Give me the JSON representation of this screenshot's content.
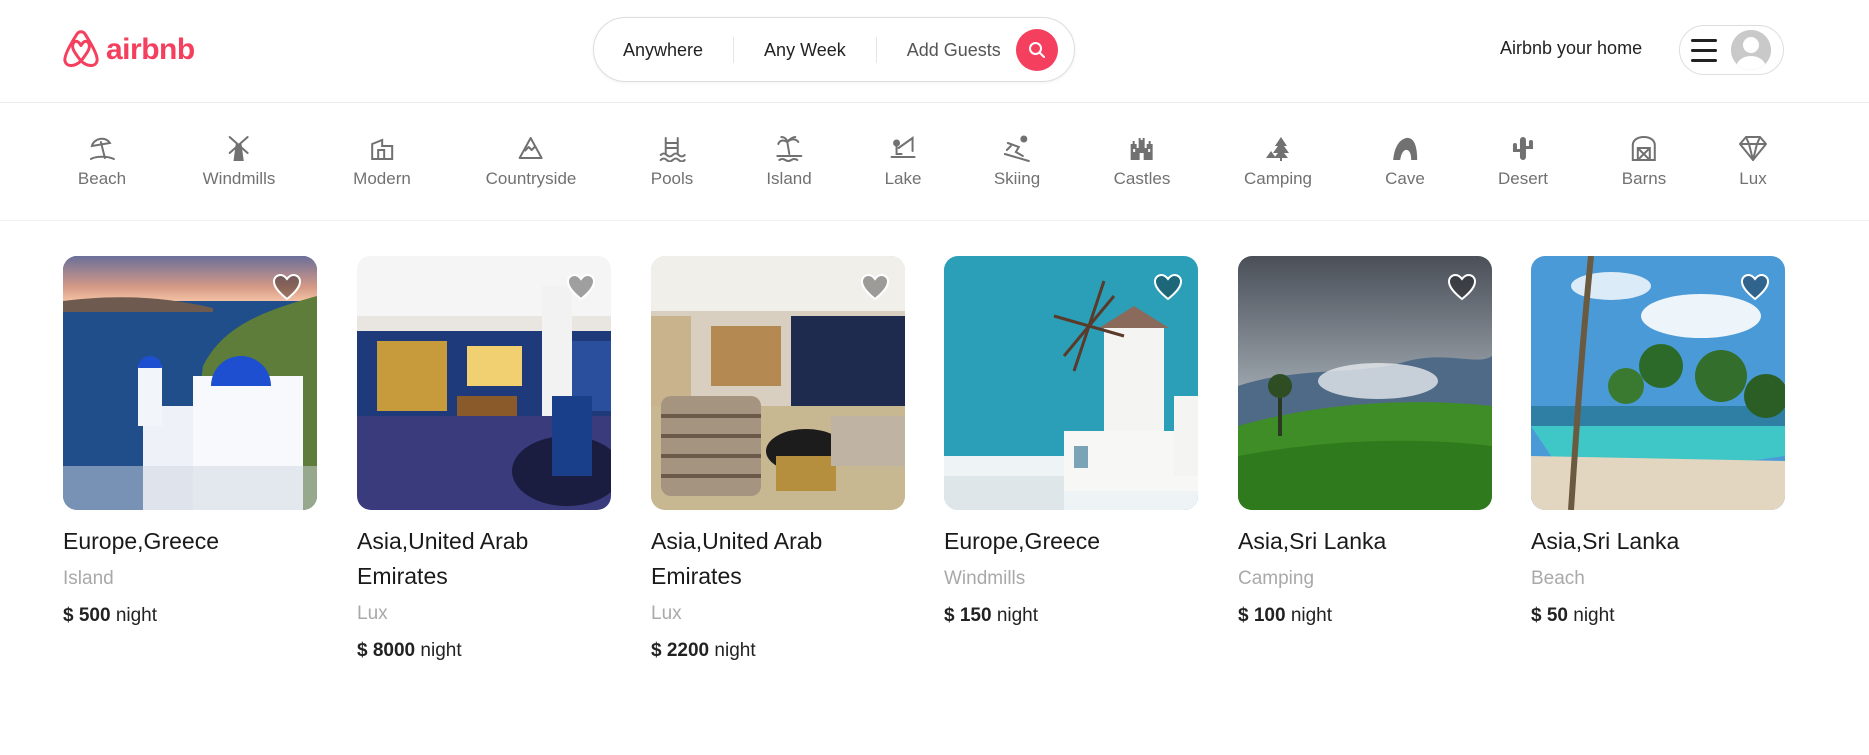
{
  "brand": {
    "name": "airbnb",
    "color": "#f43f5e"
  },
  "search": {
    "where": "Anywhere",
    "when": "Any Week",
    "guests": "Add Guests",
    "button_icon": "search-icon"
  },
  "header": {
    "host_link": "Airbnb your home",
    "menu_icon": "hamburger-icon",
    "avatar_icon": "user-avatar-icon"
  },
  "categories": [
    {
      "label": "Beach",
      "icon": "beach-umbrella-icon"
    },
    {
      "label": "Windmills",
      "icon": "windmill-icon"
    },
    {
      "label": "Modern",
      "icon": "modern-house-icon"
    },
    {
      "label": "Countryside",
      "icon": "mountain-icon"
    },
    {
      "label": "Pools",
      "icon": "pool-icon"
    },
    {
      "label": "Island",
      "icon": "island-palm-icon"
    },
    {
      "label": "Lake",
      "icon": "lake-fishing-icon"
    },
    {
      "label": "Skiing",
      "icon": "skiing-icon"
    },
    {
      "label": "Castles",
      "icon": "castle-icon"
    },
    {
      "label": "Camping",
      "icon": "camping-tree-icon"
    },
    {
      "label": "Cave",
      "icon": "cave-icon"
    },
    {
      "label": "Desert",
      "icon": "cactus-icon"
    },
    {
      "label": "Barns",
      "icon": "barn-icon"
    },
    {
      "label": "Lux",
      "icon": "diamond-icon"
    }
  ],
  "listings": [
    {
      "location": "Europe,Greece",
      "category": "Island",
      "price": "$ 500",
      "unit": "night",
      "photo": "santorini-blue-domes"
    },
    {
      "location": "Asia,United Arab Emirates",
      "category": "Lux",
      "price": "$ 8000",
      "unit": "night",
      "photo": "luxury-hotel-suite"
    },
    {
      "location": "Asia,United Arab Emirates",
      "category": "Lux",
      "price": "$ 2200",
      "unit": "night",
      "photo": "luxury-living-room"
    },
    {
      "location": "Europe,Greece",
      "category": "Windmills",
      "price": "$ 150",
      "unit": "night",
      "photo": "greek-windmill"
    },
    {
      "location": "Asia,Sri Lanka",
      "category": "Camping",
      "price": "$ 100",
      "unit": "night",
      "photo": "misty-tea-hills"
    },
    {
      "location": "Asia,Sri Lanka",
      "category": "Beach",
      "price": "$ 50",
      "unit": "night",
      "photo": "palm-infinity-pool"
    }
  ]
}
